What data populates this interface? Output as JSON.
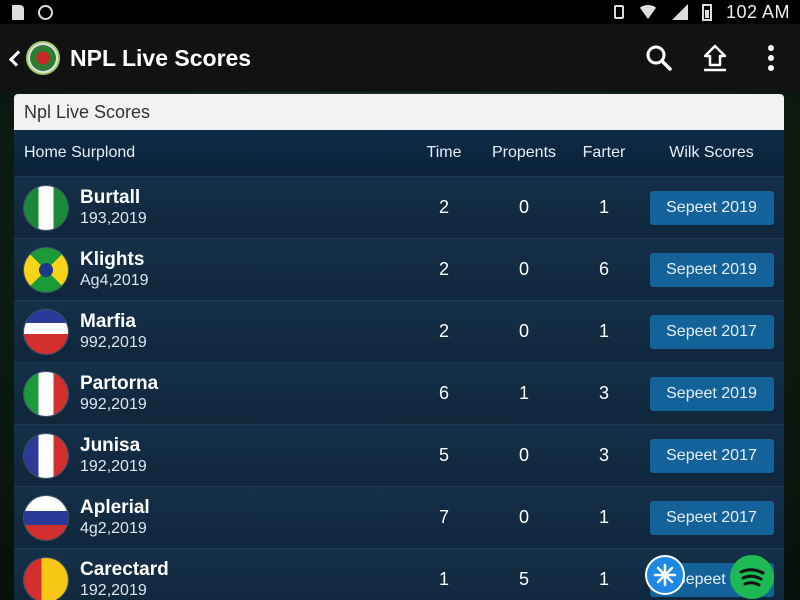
{
  "status_bar": {
    "time": "102 AM",
    "icons": [
      "sim-icon",
      "circle-icon",
      "vibrate-icon",
      "wifi-icon",
      "signal-icon",
      "battery-icon"
    ]
  },
  "app_bar": {
    "title": "NPL Live Scores",
    "icons": [
      "back-icon",
      "logo-icon",
      "search-icon",
      "share-icon",
      "more-icon"
    ]
  },
  "card": {
    "header": "Npl Live Scores",
    "columns": [
      "Home Surplond",
      "Time",
      "Propents",
      "Farter",
      "Wilk Scores"
    ],
    "rows": [
      {
        "name": "Burtall",
        "date": "193,2019",
        "time": "2",
        "propents": "0",
        "farter": "1",
        "scores_label": "Sepeet 2019",
        "flag": "nigeria"
      },
      {
        "name": "Klights",
        "date": "Ag4,2019",
        "time": "2",
        "propents": "0",
        "farter": "6",
        "scores_label": "Sepeet 2019",
        "flag": "brazil"
      },
      {
        "name": "Marfia",
        "date": "992,2019",
        "time": "2",
        "propents": "0",
        "farter": "1",
        "scores_label": "Sepeet 2017",
        "flag": "tricolor-h"
      },
      {
        "name": "Partorna",
        "date": "992,2019",
        "time": "6",
        "propents": "1",
        "farter": "3",
        "scores_label": "Sepeet 2019",
        "flag": "italy"
      },
      {
        "name": "Junisa",
        "date": "192,2019",
        "time": "5",
        "propents": "0",
        "farter": "3",
        "scores_label": "Sepeet 2017",
        "flag": "france"
      },
      {
        "name": "Aplerial",
        "date": "4g2,2019",
        "time": "7",
        "propents": "0",
        "farter": "1",
        "scores_label": "Sepeet 2017",
        "flag": "slovenia"
      },
      {
        "name": "Carectard",
        "date": "192,2019",
        "time": "1",
        "propents": "5",
        "farter": "1",
        "scores_label": "Sepeet 14",
        "flag": "red-yellow"
      }
    ]
  },
  "colors": {
    "accent": "#14629a",
    "card_bg": "#0f2236",
    "spotify_green": "#1db954"
  }
}
